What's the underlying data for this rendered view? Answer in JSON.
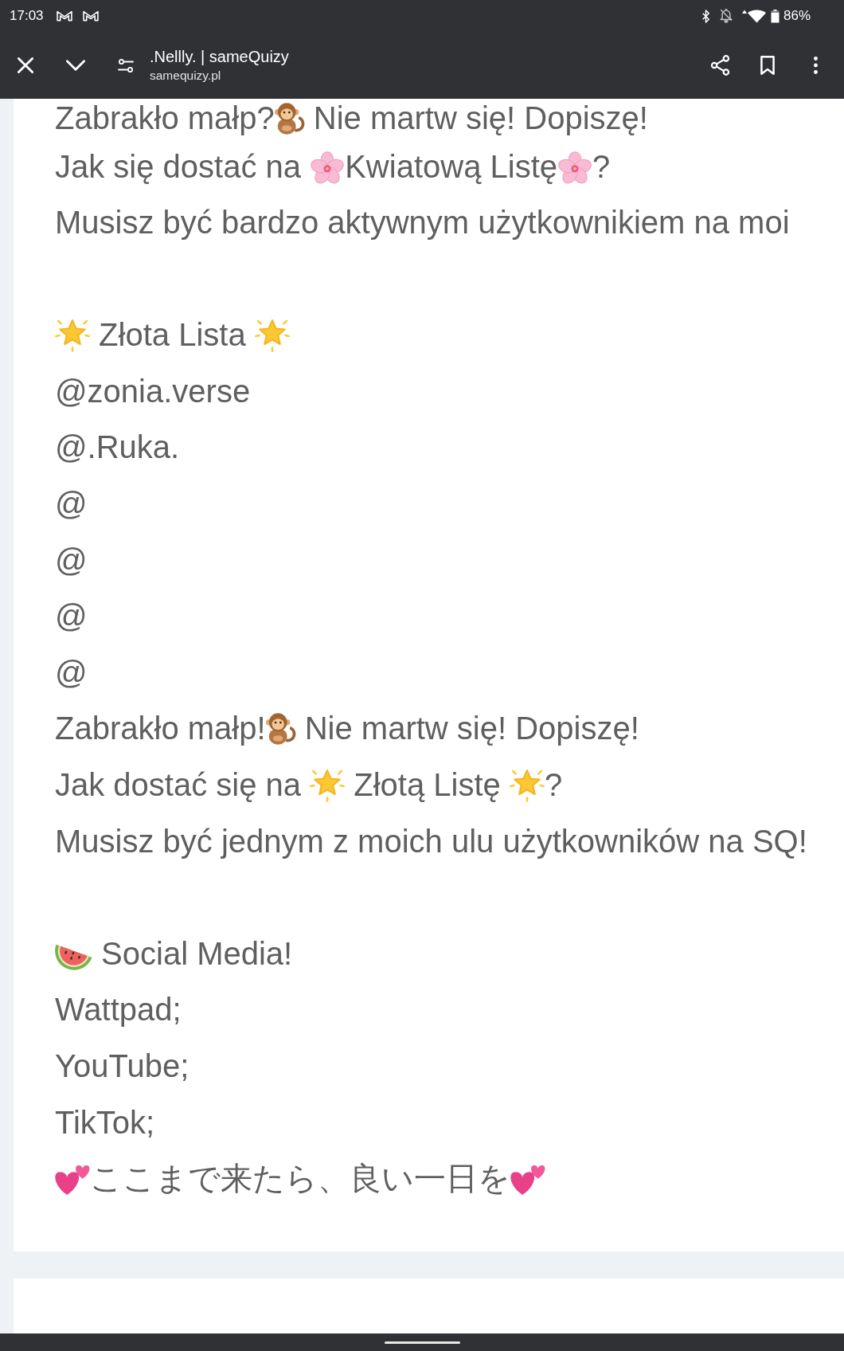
{
  "status_bar": {
    "time": "17:03",
    "battery": "86%"
  },
  "toolbar": {
    "title": ".Nellly. | sameQuizy",
    "url": "samequizy.pl"
  },
  "sections": [
    {
      "lines": [
        {
          "parts": [
            {
              "kind": "text",
              "text": "Zabrakło małp?"
            },
            {
              "kind": "monkey"
            },
            {
              "kind": "text",
              "text": " Nie martw się! Dopiszę!"
            }
          ]
        },
        {
          "parts": [
            {
              "kind": "text",
              "text": "Jak się dostać na "
            },
            {
              "kind": "blossom"
            },
            {
              "kind": "text",
              "text": "Kwiatową Listę"
            },
            {
              "kind": "blossom"
            },
            {
              "kind": "text",
              "text": "?"
            }
          ]
        },
        {
          "parts": [
            {
              "kind": "text",
              "text": "Musisz być bardzo aktywnym użytkownikiem na moi"
            }
          ]
        }
      ]
    },
    {
      "heading": {
        "parts": [
          {
            "kind": "star"
          },
          {
            "kind": "text",
            "text": " Złota Lista "
          },
          {
            "kind": "star"
          }
        ]
      },
      "lines": [
        {
          "parts": [
            {
              "kind": "text",
              "text": "@zonia.verse"
            }
          ]
        },
        {
          "parts": [
            {
              "kind": "text",
              "text": "@.Ruka."
            }
          ]
        },
        {
          "parts": [
            {
              "kind": "text",
              "text": "@"
            }
          ]
        },
        {
          "parts": [
            {
              "kind": "text",
              "text": "@"
            }
          ]
        },
        {
          "parts": [
            {
              "kind": "text",
              "text": "@"
            }
          ]
        },
        {
          "parts": [
            {
              "kind": "text",
              "text": "@"
            }
          ]
        },
        {
          "parts": [
            {
              "kind": "text",
              "text": "Zabrakło małp!"
            },
            {
              "kind": "monkey"
            },
            {
              "kind": "text",
              "text": " Nie martw się! Dopiszę!"
            }
          ]
        },
        {
          "parts": [
            {
              "kind": "text",
              "text": "Jak dostać się na "
            },
            {
              "kind": "star"
            },
            {
              "kind": "text",
              "text": " Złotą Listę "
            },
            {
              "kind": "star"
            },
            {
              "kind": "text",
              "text": "?"
            }
          ]
        },
        {
          "parts": [
            {
              "kind": "text",
              "text": "Musisz być jednym z moich ulu użytkowników na SQ!"
            }
          ]
        }
      ]
    },
    {
      "heading": {
        "parts": [
          {
            "kind": "watermelon"
          },
          {
            "kind": "text",
            "text": " Social Media!"
          }
        ]
      },
      "lines": [
        {
          "parts": [
            {
              "kind": "text",
              "text": "Wattpad;"
            }
          ]
        },
        {
          "parts": [
            {
              "kind": "text",
              "text": "YouTube;"
            }
          ]
        },
        {
          "parts": [
            {
              "kind": "text",
              "text": "TikTok;"
            }
          ]
        },
        {
          "parts": [
            {
              "kind": "hearts"
            },
            {
              "kind": "text",
              "text": "ここまで来たら、良い一日を"
            },
            {
              "kind": "hearts"
            }
          ]
        }
      ]
    }
  ]
}
